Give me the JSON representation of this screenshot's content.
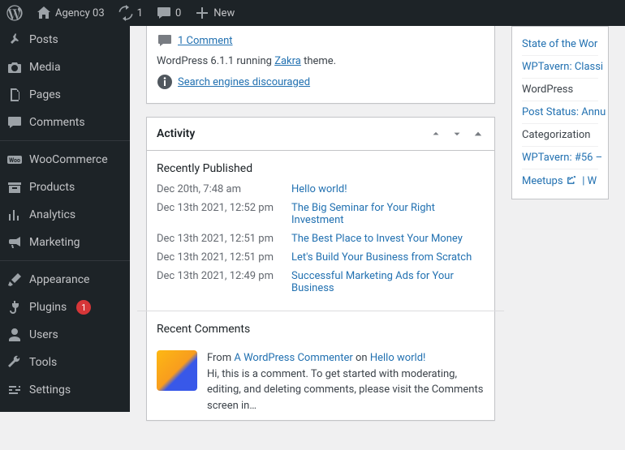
{
  "adminbar": {
    "site_name": "Agency 03",
    "updates_count": "1",
    "comments_count": "0",
    "new_label": "New"
  },
  "menu": {
    "items": [
      {
        "id": "posts",
        "label": "Posts",
        "icon": "pin"
      },
      {
        "id": "media",
        "label": "Media",
        "icon": "camera"
      },
      {
        "id": "pages",
        "label": "Pages",
        "icon": "page"
      },
      {
        "id": "comments",
        "label": "Comments",
        "icon": "comment"
      }
    ],
    "items2": [
      {
        "id": "woocommerce",
        "label": "WooCommerce",
        "icon": "woo"
      },
      {
        "id": "products",
        "label": "Products",
        "icon": "archive"
      },
      {
        "id": "analytics",
        "label": "Analytics",
        "icon": "chart"
      },
      {
        "id": "marketing",
        "label": "Marketing",
        "icon": "megaphone"
      }
    ],
    "items3": [
      {
        "id": "appearance",
        "label": "Appearance",
        "icon": "brush"
      },
      {
        "id": "plugins",
        "label": "Plugins",
        "icon": "plug",
        "badge": "1"
      },
      {
        "id": "users",
        "label": "Users",
        "icon": "user"
      },
      {
        "id": "tools",
        "label": "Tools",
        "icon": "wrench"
      },
      {
        "id": "settings",
        "label": "Settings",
        "icon": "sliders"
      }
    ]
  },
  "glance": {
    "comment_link": "1 Comment",
    "wp_version_pre": "WordPress 6.1.1 running ",
    "theme_name": "Zakra",
    "wp_version_post": " theme.",
    "seo_warning": "Search engines discouraged"
  },
  "activity": {
    "title": "Activity",
    "recently_published_heading": "Recently Published",
    "posts": [
      {
        "date": "Dec 20th, 7:48 am",
        "title": "Hello world!"
      },
      {
        "date": "Dec 13th 2021, 12:52 pm",
        "title": "The Big Seminar for Your Right Investment"
      },
      {
        "date": "Dec 13th 2021, 12:51 pm",
        "title": "The Best Place to Invest Your Money"
      },
      {
        "date": "Dec 13th 2021, 12:51 pm",
        "title": "Let's Build Your Business from Scratch"
      },
      {
        "date": "Dec 13th 2021, 12:49 pm",
        "title": "Successful Marketing Ads for Your Business"
      }
    ],
    "recent_comments_heading": "Recent Comments",
    "comment": {
      "from_label": "From",
      "author": "A WordPress Commenter",
      "on_label": "on",
      "post_title": "Hello world!",
      "body": "Hi, this is a comment. To get started with moderating, editing, and deleting comments, please visit the Comments screen in…"
    }
  },
  "side": {
    "links": [
      "State of the Wor",
      "WPTavern: Classi",
      "WordPress",
      "Post Status: Annu",
      "Categorization",
      "WPTavern: #56 –"
    ],
    "meetups_label": "Meetups",
    "w_label": "W"
  }
}
